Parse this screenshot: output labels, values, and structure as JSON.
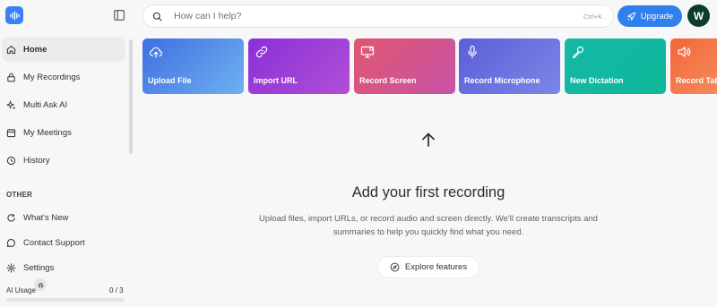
{
  "sidebar": {
    "items": [
      {
        "label": "Home",
        "icon": "home-icon"
      },
      {
        "label": "My Recordings",
        "icon": "lock-icon"
      },
      {
        "label": "Multi Ask AI",
        "icon": "sparkles-icon"
      },
      {
        "label": "My Meetings",
        "icon": "calendar-icon"
      },
      {
        "label": "History",
        "icon": "history-icon"
      }
    ],
    "other_label": "OTHER",
    "other_items": [
      {
        "label": "What's New",
        "icon": "refresh-icon"
      },
      {
        "label": "Contact Support",
        "icon": "chat-icon"
      },
      {
        "label": "Settings",
        "icon": "gear-icon"
      }
    ],
    "usage": {
      "label": "AI Usage",
      "count": "0 / 3",
      "fraction": 0
    }
  },
  "search": {
    "placeholder": "How can I help?",
    "shortcut": "Ctrl+K"
  },
  "upgrade_label": "Upgrade",
  "avatar_initial": "W",
  "cards": [
    {
      "label": "Upload File",
      "icon": "cloud-upload-icon",
      "color_from": "#3f6fe0",
      "color_to": "#6fb0f2"
    },
    {
      "label": "Import URL",
      "icon": "link-icon",
      "color_from": "#8b2fd8",
      "color_to": "#b04fd6"
    },
    {
      "label": "Record Screen",
      "icon": "monitor-icon",
      "color_from": "#e0566f",
      "color_to": "#c854a8"
    },
    {
      "label": "Record Microphone",
      "icon": "microphone-icon",
      "color_from": "#5a5fd6",
      "color_to": "#7d86e8"
    },
    {
      "label": "New Dictation",
      "icon": "pen-icon",
      "color_from": "#14b8a6",
      "color_to": "#0fb89b"
    },
    {
      "label": "Record Tab",
      "icon": "speaker-icon",
      "color_from": "#f2663a",
      "color_to": "#f58a5a"
    }
  ],
  "empty_state": {
    "title": "Add your first recording",
    "description": "Upload files, import URLs, or record audio and screen directly. We'll create transcripts and summaries to help you quickly find what you need.",
    "explore_label": "Explore features"
  },
  "colors": {
    "accent": "#2f80ed",
    "avatar": "#0d3b2e"
  }
}
